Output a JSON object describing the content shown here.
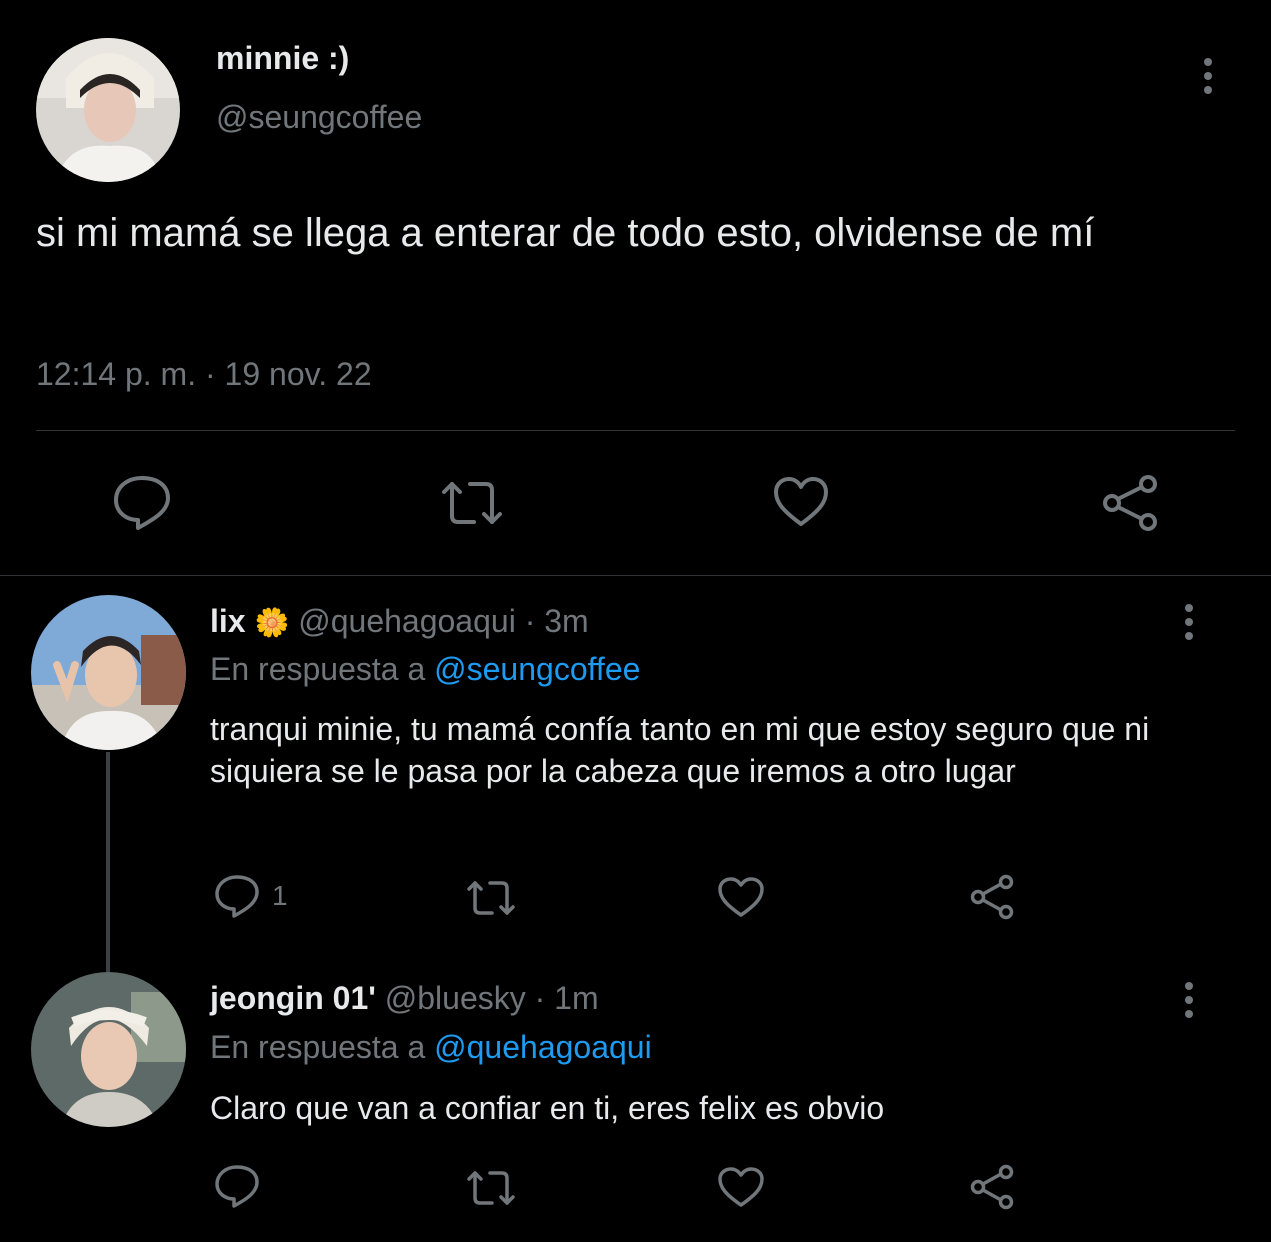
{
  "main_tweet": {
    "display_name": "minnie :)",
    "handle": "@seungcoffee",
    "text": "si mi mamá se llega a enterar de todo esto, olvidense de mí",
    "timestamp": "12:14 p. m. · 19 nov. 22",
    "avatar_icon": "profile-photo",
    "actions": [
      "reply-icon",
      "retweet-icon",
      "like-icon",
      "share-icon"
    ]
  },
  "replies": [
    {
      "display_name": "lix",
      "emoji": "🌼",
      "handle": "@quehagoaqui",
      "time": "· 3m",
      "reply_prefix": "En respuesta a",
      "reply_to": "@seungcoffee",
      "text": "tranqui minie, tu mamá confía tanto en mi que estoy seguro que ni siquiera se le pasa por la cabeza que iremos a otro lugar",
      "reply_count": "1"
    },
    {
      "display_name": "jeongin 01'",
      "handle": "@bluesky",
      "time": "· 1m",
      "reply_prefix": "En respuesta a",
      "reply_to": "@quehagoaqui",
      "text": "Claro que van a confiar en ti, eres felix es obvio",
      "reply_count": ""
    }
  ],
  "colors": {
    "background": "#000000",
    "text": "#e7e9ea",
    "muted": "#71767b",
    "link": "#1d9bf0",
    "divider": "#2f3336"
  }
}
